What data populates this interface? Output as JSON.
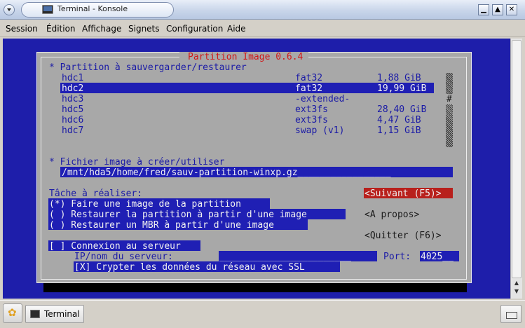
{
  "window": {
    "title": "Terminal - Konsole",
    "buttons": {
      "minimize": "▁",
      "maximize": "▲",
      "close": "✕"
    }
  },
  "menubar": [
    "Session",
    "Édition",
    "Affichage",
    "Signets",
    "Configuration",
    "Aide"
  ],
  "dialog": {
    "title": "Partition Image 0.6.4",
    "partition_header": "* Partition à sauvergarder/restaurer",
    "partitions": [
      {
        "name": "hdc1",
        "fs": "fat32",
        "size": "1,88 GiB",
        "selected": false
      },
      {
        "name": "hdc2",
        "fs": "fat32",
        "size": "19,99 GiB",
        "selected": true
      },
      {
        "name": "hdc3",
        "fs": "-extended-",
        "size": "",
        "selected": false
      },
      {
        "name": "hdc5",
        "fs": "ext3fs",
        "size": "28,40 GiB",
        "selected": false
      },
      {
        "name": "hdc6",
        "fs": "ext3fs",
        "size": "4,47 GiB",
        "selected": false
      },
      {
        "name": "hdc7",
        "fs": "swap (v1)",
        "size": "1,15 GiB",
        "selected": false
      }
    ],
    "scroll_marker": "#",
    "image_file_header": "* Fichier image à créer/utiliser",
    "image_file_value": "/mnt/hda5/home/fred/sauv-partition-winxp.gz_________________",
    "task_label": "Tâche à réaliser:",
    "task_options": [
      "(*) Faire une image de la partition",
      "( ) Restaurer la partition à partir d'une image",
      "( ) Restaurer un MBR à partir d'une image"
    ],
    "next_button": "<Suivant (F5)>",
    "about_button": "<A propos>",
    "quit_button": "<Quitter (F6)>",
    "server_checkbox": "[ ] Connexion au serveur",
    "server_ip_label": "IP/nom du serveur:",
    "server_ip_value": "________________________",
    "port_label": "Port:",
    "port_value": "4025__",
    "ssl_checkbox": "[X] Crypter les données du réseau avec SSL"
  },
  "taskbar": {
    "task_label": "Terminal"
  },
  "colors": {
    "terminal_bg": "#1e1eaa",
    "dialog_bg": "#a8a8a8",
    "highlight": "#1f1fb4",
    "accent_red": "#d01818"
  }
}
